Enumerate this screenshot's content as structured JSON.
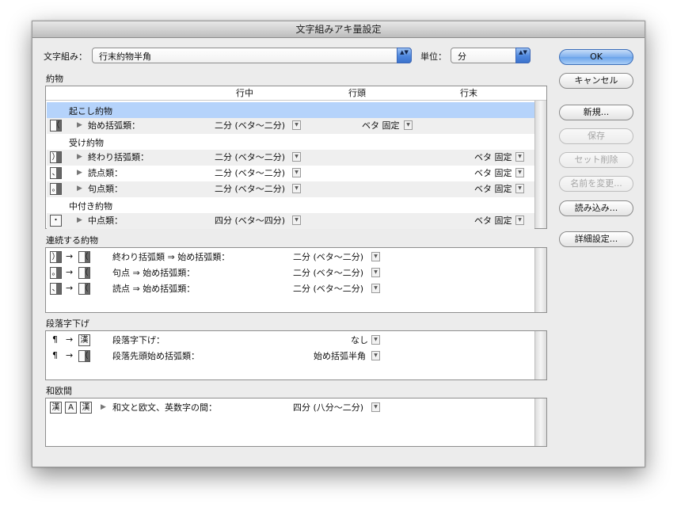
{
  "window": {
    "title": "文字組みアキ量設定"
  },
  "top": {
    "mojikumi_label": "文字組み：",
    "mojikumi_value": "行末約物半角",
    "unit_label": "単位：",
    "unit_value": "分"
  },
  "buttons": {
    "ok": "OK",
    "cancel": "キャンセル",
    "new": "新規...",
    "save": "保存",
    "delete_set": "セット削除",
    "rename": "名前を変更...",
    "load": "読み込み...",
    "detail": "詳細設定..."
  },
  "yakumono": {
    "title": "約物",
    "columns": [
      "行中",
      "行頭",
      "行末"
    ],
    "groups": [
      {
        "name": "起こし約物",
        "rows": [
          {
            "label": "始め括弧類：",
            "mid": "二分 (ベタ〜二分)",
            "head": "ベタ 固定",
            "tail": ""
          }
        ]
      },
      {
        "name": "受け約物",
        "rows": [
          {
            "label": "終わり括弧類：",
            "mid": "二分 (ベタ〜二分)",
            "head": "",
            "tail": "ベタ 固定"
          },
          {
            "label": "読点類：",
            "mid": "二分 (ベタ〜二分)",
            "head": "",
            "tail": "ベタ 固定"
          },
          {
            "label": "句点類：",
            "mid": "二分 (ベタ〜二分)",
            "head": "",
            "tail": "ベタ 固定"
          }
        ]
      },
      {
        "name": "中付き約物",
        "rows": [
          {
            "label": "中点類：",
            "mid": "四分 (ベタ〜四分)",
            "head": "",
            "tail": "ベタ 固定"
          }
        ]
      }
    ]
  },
  "continuous": {
    "title": "連続する約物",
    "rows": [
      {
        "label": "終わり括弧類 ⇒ 始め括弧類：",
        "value": "二分 (ベタ〜二分)"
      },
      {
        "label": "句点 ⇒ 始め括弧類：",
        "value": "二分 (ベタ〜二分)"
      },
      {
        "label": "読点 ⇒ 始め括弧類：",
        "value": "二分 (ベタ〜二分)"
      }
    ]
  },
  "indent": {
    "title": "段落字下げ",
    "rows": [
      {
        "label": "段落字下げ：",
        "value": "なし"
      },
      {
        "label": "段落先頭始め括弧類：",
        "value": "始め括弧半角"
      }
    ]
  },
  "wao": {
    "title": "和欧間",
    "rows": [
      {
        "label": "和文と欧文、英数字の間：",
        "value": "四分 (八分〜二分)"
      }
    ]
  },
  "glyphs": {
    "open_bracket": "（",
    "close_bracket": "）",
    "comma": "、",
    "period": "。",
    "middle_dot": "・",
    "pilcrow": "¶",
    "kanji": "漢",
    "alpha": "A",
    "arrow": "→",
    "disclosure": "▶",
    "dropdown": "▼",
    "updown": "▲▼"
  }
}
